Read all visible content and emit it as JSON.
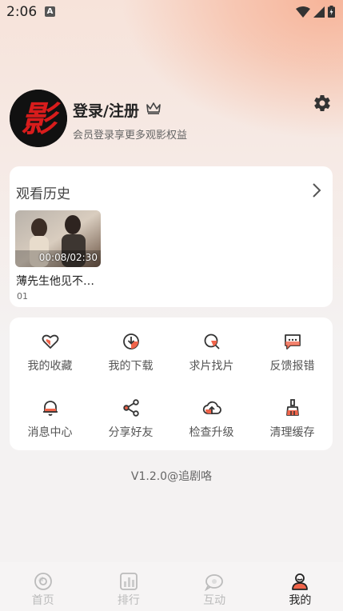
{
  "status_bar": {
    "time": "2:06",
    "notification_glyph": "A"
  },
  "profile": {
    "login_title": "登录/注册",
    "subtitle": "会员登录享更多观影权益",
    "avatar_glyph": "影"
  },
  "history": {
    "title": "观看历史",
    "items": [
      {
        "title": "薄先生他见不…",
        "episode": "01",
        "progress": "00:08/02:30"
      }
    ]
  },
  "menu": {
    "items": [
      {
        "label": "我的收藏",
        "icon": "heart-icon"
      },
      {
        "label": "我的下载",
        "icon": "download-icon"
      },
      {
        "label": "求片找片",
        "icon": "search-film-icon"
      },
      {
        "label": "反馈报错",
        "icon": "feedback-icon"
      },
      {
        "label": "消息中心",
        "icon": "bell-icon"
      },
      {
        "label": "分享好友",
        "icon": "share-icon"
      },
      {
        "label": "检查升级",
        "icon": "upgrade-icon"
      },
      {
        "label": "清理缓存",
        "icon": "clean-icon"
      }
    ]
  },
  "version_text": "V1.2.0@追剧咯",
  "tabs": [
    {
      "label": "首页",
      "active": false
    },
    {
      "label": "排行",
      "active": false
    },
    {
      "label": "互动",
      "active": false
    },
    {
      "label": "我的",
      "active": true
    }
  ],
  "colors": {
    "accent": "#f0644a",
    "card": "#ffffff",
    "background": "#f4f2f2"
  }
}
